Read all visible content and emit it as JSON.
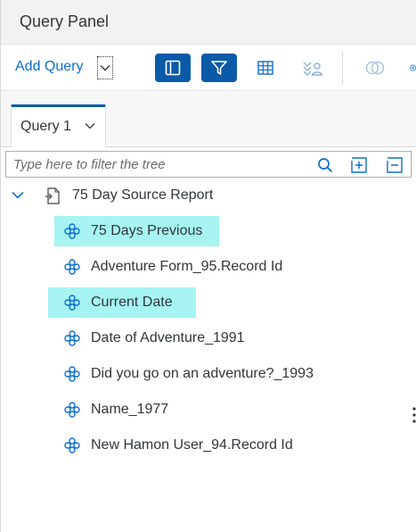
{
  "panel": {
    "title": "Query Panel"
  },
  "toolbar": {
    "add_query_label": "Add Query",
    "buttons": [
      {
        "icon": "sidebar-panel-icon",
        "active": true
      },
      {
        "icon": "filter-icon",
        "active": true
      },
      {
        "icon": "table-grid-icon",
        "active": false
      },
      {
        "icon": "data-users-icon",
        "active": false
      },
      {
        "icon": "join-circles-icon",
        "active": false
      },
      {
        "icon": "settings-icon",
        "active": false
      }
    ]
  },
  "tabs": [
    {
      "label": "Query 1",
      "active": true
    }
  ],
  "filter": {
    "placeholder": "Type here to filter the tree"
  },
  "tree": {
    "root": {
      "label": "75 Day Source Report",
      "expanded": true,
      "icon": "report-source-icon"
    },
    "items": [
      {
        "label": "75 Days Previous",
        "selected": true,
        "icon": "object-node-icon"
      },
      {
        "label": "Adventure Form_95.Record Id",
        "selected": false,
        "icon": "object-node-icon"
      },
      {
        "label": "Current Date",
        "selected": true,
        "icon": "object-node-icon"
      },
      {
        "label": "Date of Adventure_1991",
        "selected": false,
        "icon": "object-node-icon"
      },
      {
        "label": "Did you go on an adventure?_1993",
        "selected": false,
        "icon": "object-node-icon"
      },
      {
        "label": "Name_1977",
        "selected": false,
        "icon": "object-node-icon"
      },
      {
        "label": "New Hamon User_94.Record Id",
        "selected": false,
        "icon": "object-node-icon"
      }
    ]
  },
  "colors": {
    "accent": "#0a5aa8",
    "link": "#0a6ed1",
    "selection": "#a6f5f2",
    "icon_blue": "#0a6ed1"
  }
}
